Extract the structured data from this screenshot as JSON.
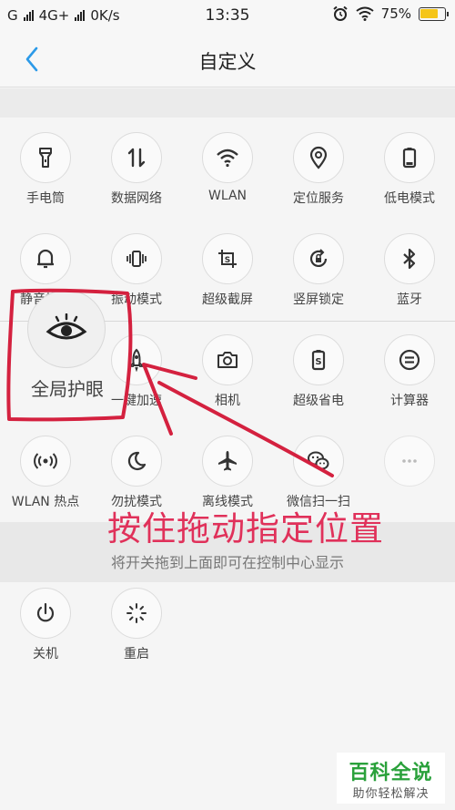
{
  "status_bar": {
    "carrier_1": "G",
    "network": "4G+",
    "speed": "0K/s",
    "time": "13:35",
    "battery": "75%",
    "battery_level": 0.75,
    "battery_color": "#f5c518"
  },
  "nav": {
    "title": "自定义",
    "back_icon": "chevron-left-icon",
    "accent_color": "#2c9ae8"
  },
  "active_tiles": [
    {
      "label": "手电筒",
      "icon": "flashlight-icon"
    },
    {
      "label": "数据网络",
      "icon": "data-network-icon"
    },
    {
      "label": "WLAN",
      "icon": "wifi-icon"
    },
    {
      "label": "定位服务",
      "icon": "location-icon"
    },
    {
      "label": "低电模式",
      "icon": "low-battery-icon"
    },
    {
      "label": "静音模式",
      "icon": "bell-icon"
    },
    {
      "label": "振动模式",
      "icon": "vibrate-icon"
    },
    {
      "label": "超级截屏",
      "icon": "screenshot-icon"
    },
    {
      "label": "竖屏锁定",
      "icon": "rotation-lock-icon"
    },
    {
      "label": "蓝牙",
      "icon": "bluetooth-icon"
    }
  ],
  "inactive_tiles": [
    {
      "label": "一键加速",
      "icon": "rocket-icon"
    },
    {
      "label": "相机",
      "icon": "camera-icon"
    },
    {
      "label": "超级省电",
      "icon": "super-power-save-icon"
    },
    {
      "label": "计算器",
      "icon": "calculator-icon"
    },
    {
      "label": "WLAN 热点",
      "icon": "hotspot-icon"
    },
    {
      "label": "勿扰模式",
      "icon": "moon-icon"
    },
    {
      "label": "离线模式",
      "icon": "airplane-icon"
    },
    {
      "label": "微信扫一扫",
      "icon": "wechat-icon"
    },
    {
      "label": "",
      "icon": "more-icon"
    }
  ],
  "dragging_tile": {
    "label": "全局护眼",
    "icon": "eye-icon"
  },
  "hint": "将开关拖到上面即可在控制中心显示",
  "bottom_tiles": [
    {
      "label": "关机",
      "icon": "power-icon"
    },
    {
      "label": "重启",
      "icon": "restart-icon"
    }
  ],
  "annotation": {
    "text": "按住拖动指定位置",
    "color": "#e0315a"
  },
  "watermark": {
    "title": "百科全说",
    "subtitle": "助你轻松解决",
    "color": "#2aa13b"
  }
}
